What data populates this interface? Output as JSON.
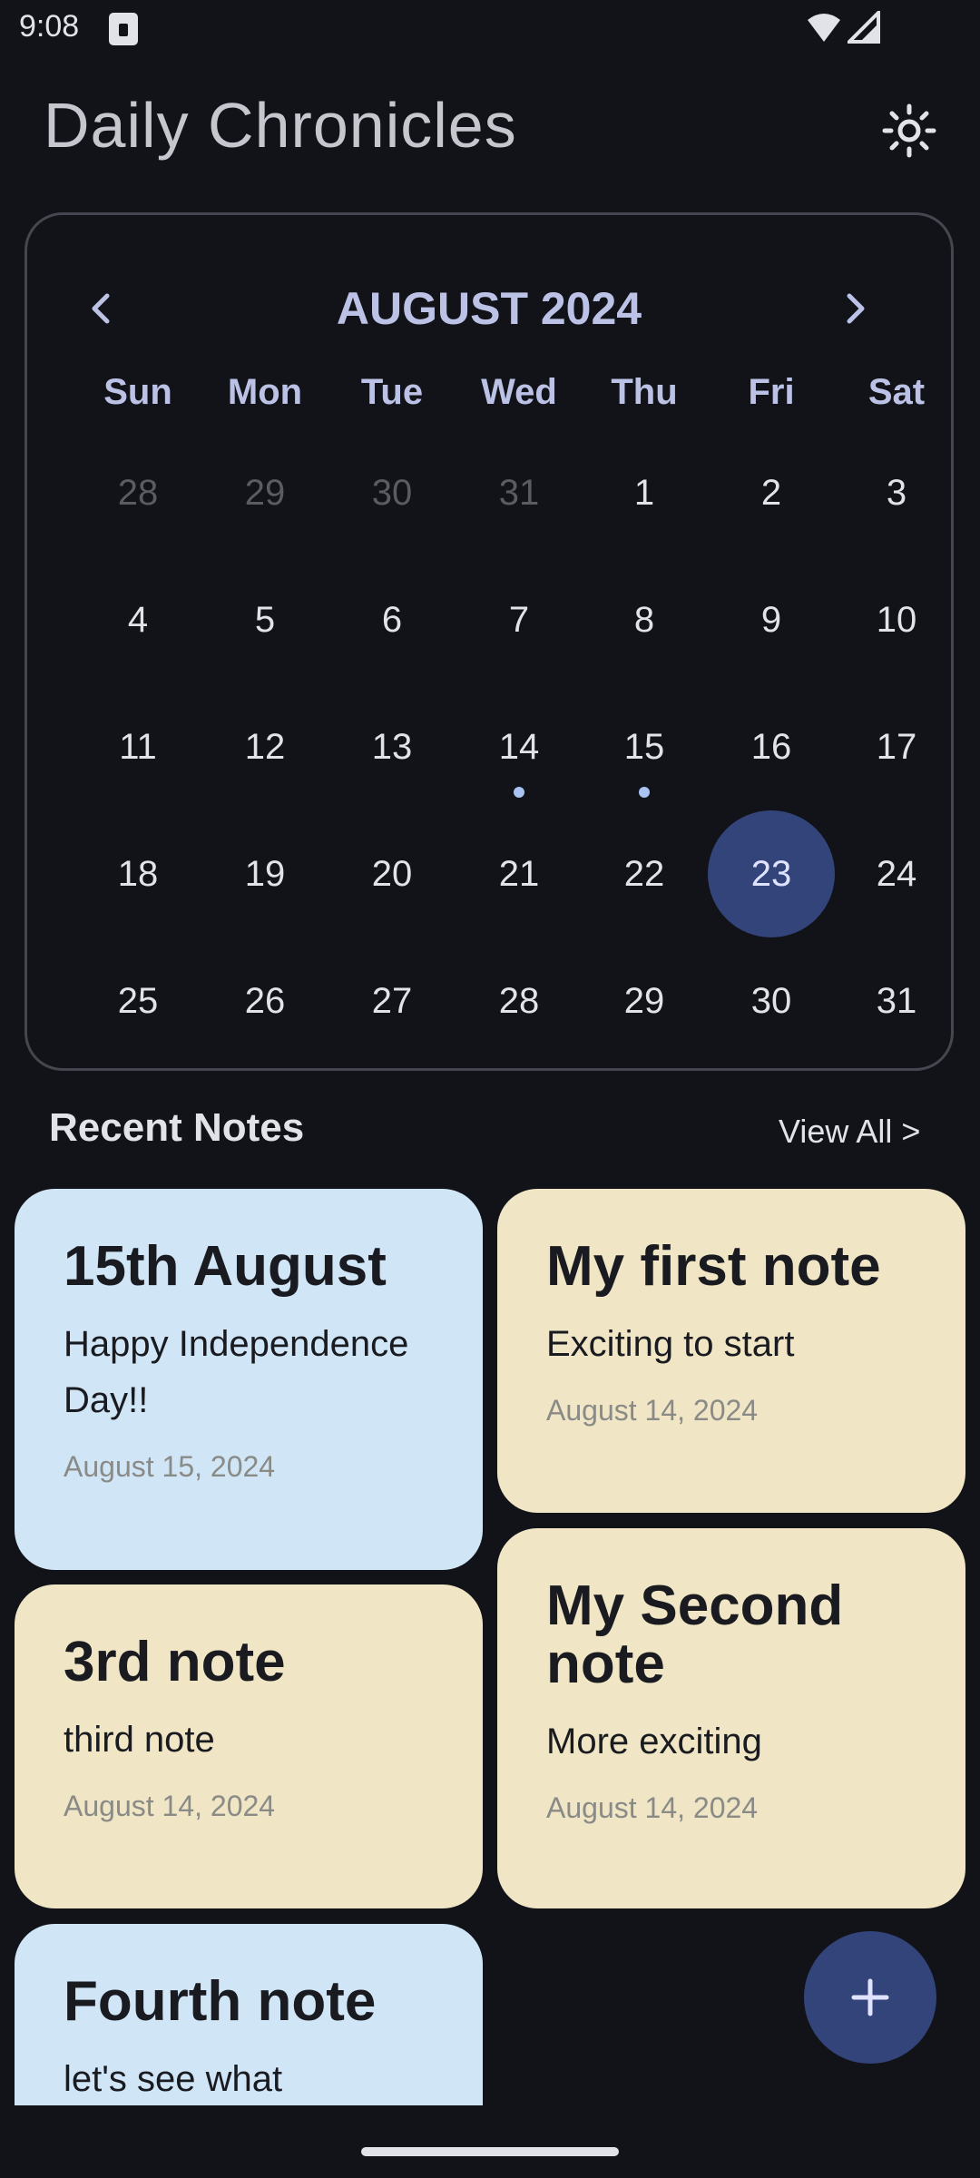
{
  "status_bar": {
    "time": "9:08"
  },
  "app": {
    "title": "Daily Chronicles"
  },
  "calendar": {
    "month_label": "AUGUST 2024",
    "weekdays": [
      "Sun",
      "Mon",
      "Tue",
      "Wed",
      "Thu",
      "Fri",
      "Sat"
    ],
    "weeks": [
      [
        "28",
        "29",
        "30",
        "31",
        "1",
        "2",
        "3"
      ],
      [
        "4",
        "5",
        "6",
        "7",
        "8",
        "9",
        "10"
      ],
      [
        "11",
        "12",
        "13",
        "14",
        "15",
        "16",
        "17"
      ],
      [
        "18",
        "19",
        "20",
        "21",
        "22",
        "23",
        "24"
      ],
      [
        "25",
        "26",
        "27",
        "28",
        "29",
        "30",
        "31"
      ]
    ],
    "muted_days": [
      "28",
      "29",
      "30",
      "31"
    ],
    "selected_day": "23",
    "days_with_notes": [
      "14",
      "15"
    ]
  },
  "recent": {
    "title": "Recent Notes",
    "view_all": "View All >"
  },
  "notes": [
    {
      "title": "15th August",
      "body": "Happy Independence Day!!",
      "date": "August 15, 2024",
      "color": "#d0e6f7"
    },
    {
      "title": "My first note",
      "body": "Exciting to start",
      "date": "August 14, 2024",
      "color": "#f0e6c6"
    },
    {
      "title": "3rd note",
      "body": "third note",
      "date": "August 14, 2024",
      "color": "#f0e6c6"
    },
    {
      "title": "My Second note",
      "body": "More exciting",
      "date": "August 14, 2024",
      "color": "#f0e6c6"
    },
    {
      "title": "Fourth note",
      "body": "let's see what",
      "date": "",
      "color": "#d0e6f7"
    }
  ],
  "icons": {
    "theme": "sun-icon",
    "prev": "chevron-left-icon",
    "next": "chevron-right-icon",
    "fab": "plus-icon"
  }
}
